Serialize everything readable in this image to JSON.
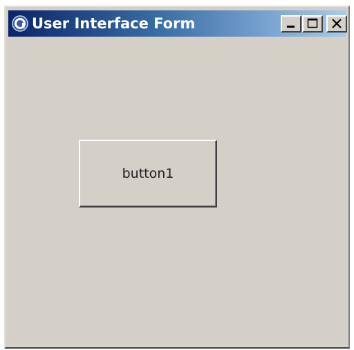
{
  "window": {
    "title": "User Interface Form",
    "app_icon": "app-logo-icon",
    "caption_buttons": {
      "minimize_icon": "minimize-icon",
      "maximize_icon": "maximize-icon",
      "close_icon": "close-icon"
    }
  },
  "form": {
    "button1_label": "button1"
  },
  "colors": {
    "titlebar_start": "#0a246a",
    "titlebar_end": "#a6caf0",
    "face": "#d4d0c8"
  }
}
